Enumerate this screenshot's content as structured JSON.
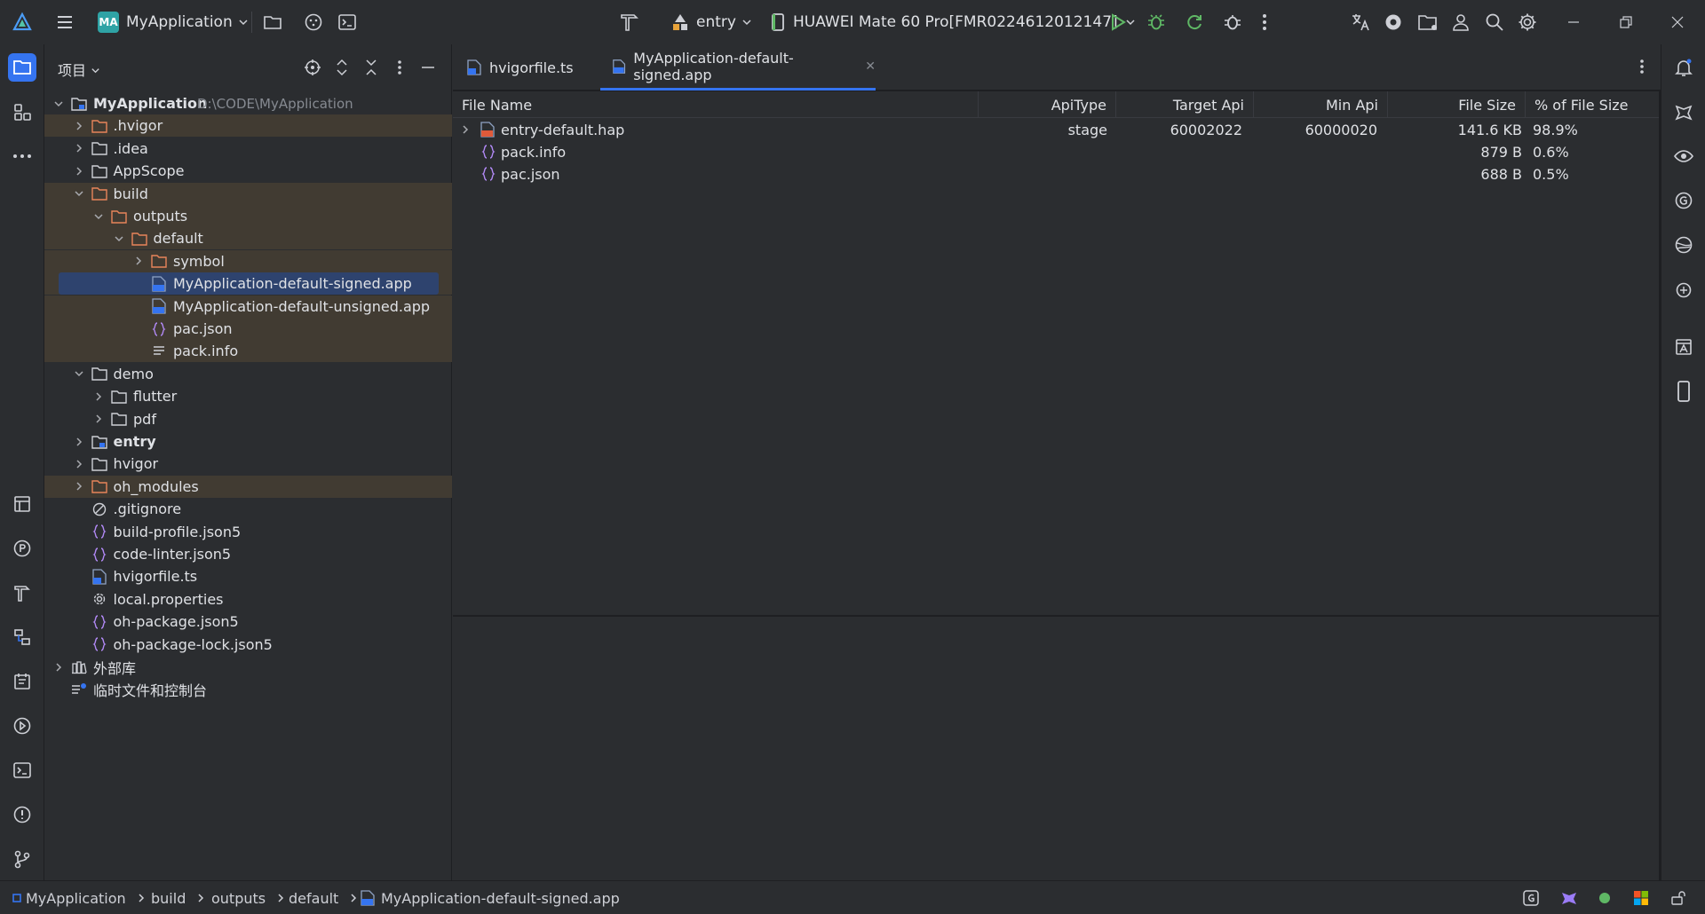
{
  "toolbar": {
    "project_badge": "MA",
    "project_name": "MyApplication",
    "run_config": "entry",
    "device": "HUAWEI Mate 60 Pro[FMR0224612012147]"
  },
  "project_panel": {
    "title": "项目",
    "root_name": "MyApplication",
    "root_path": "D:\\CODE\\MyApplication",
    "items": [
      {
        "label": ".hvigor"
      },
      {
        "label": ".idea"
      },
      {
        "label": "AppScope"
      },
      {
        "label": "build"
      },
      {
        "label": "outputs"
      },
      {
        "label": "default"
      },
      {
        "label": "symbol"
      },
      {
        "label": "MyApplication-default-signed.app"
      },
      {
        "label": "MyApplication-default-unsigned.app"
      },
      {
        "label": "pac.json"
      },
      {
        "label": "pack.info"
      },
      {
        "label": "demo"
      },
      {
        "label": "flutter"
      },
      {
        "label": "pdf"
      },
      {
        "label": "entry"
      },
      {
        "label": "hvigor"
      },
      {
        "label": "oh_modules"
      },
      {
        "label": ".gitignore"
      },
      {
        "label": "build-profile.json5"
      },
      {
        "label": "code-linter.json5"
      },
      {
        "label": "hvigorfile.ts"
      },
      {
        "label": "local.properties"
      },
      {
        "label": "oh-package.json5"
      },
      {
        "label": "oh-package-lock.json5"
      },
      {
        "label": "外部库"
      },
      {
        "label": "临时文件和控制台"
      }
    ]
  },
  "tabs": [
    {
      "label": "hvigorfile.ts"
    },
    {
      "label": "MyApplication-default-signed.app"
    }
  ],
  "table": {
    "headers": [
      "File Name",
      "ApiType",
      "Target Api",
      "Min Api",
      "File Size",
      "% of File Size"
    ],
    "rows": [
      {
        "name": "entry-default.hap",
        "api_type": "stage",
        "target_api": "60002022",
        "min_api": "60000020",
        "size": "141.6 KB",
        "percent": "98.9%"
      },
      {
        "name": "pack.info",
        "api_type": "",
        "target_api": "",
        "min_api": "",
        "size": "879 B",
        "percent": "0.6%"
      },
      {
        "name": "pac.json",
        "api_type": "",
        "target_api": "",
        "min_api": "",
        "size": "688 B",
        "percent": "0.5%"
      }
    ]
  },
  "breadcrumb": [
    "MyApplication",
    "build",
    "outputs",
    "default",
    "MyApplication-default-signed.app"
  ],
  "colors": {
    "accent": "#3574f0",
    "excluded_bg": "#413b32",
    "selected_bg": "#2e436e",
    "run_green": "#5fb865",
    "folder_orange": "#e8845a"
  }
}
